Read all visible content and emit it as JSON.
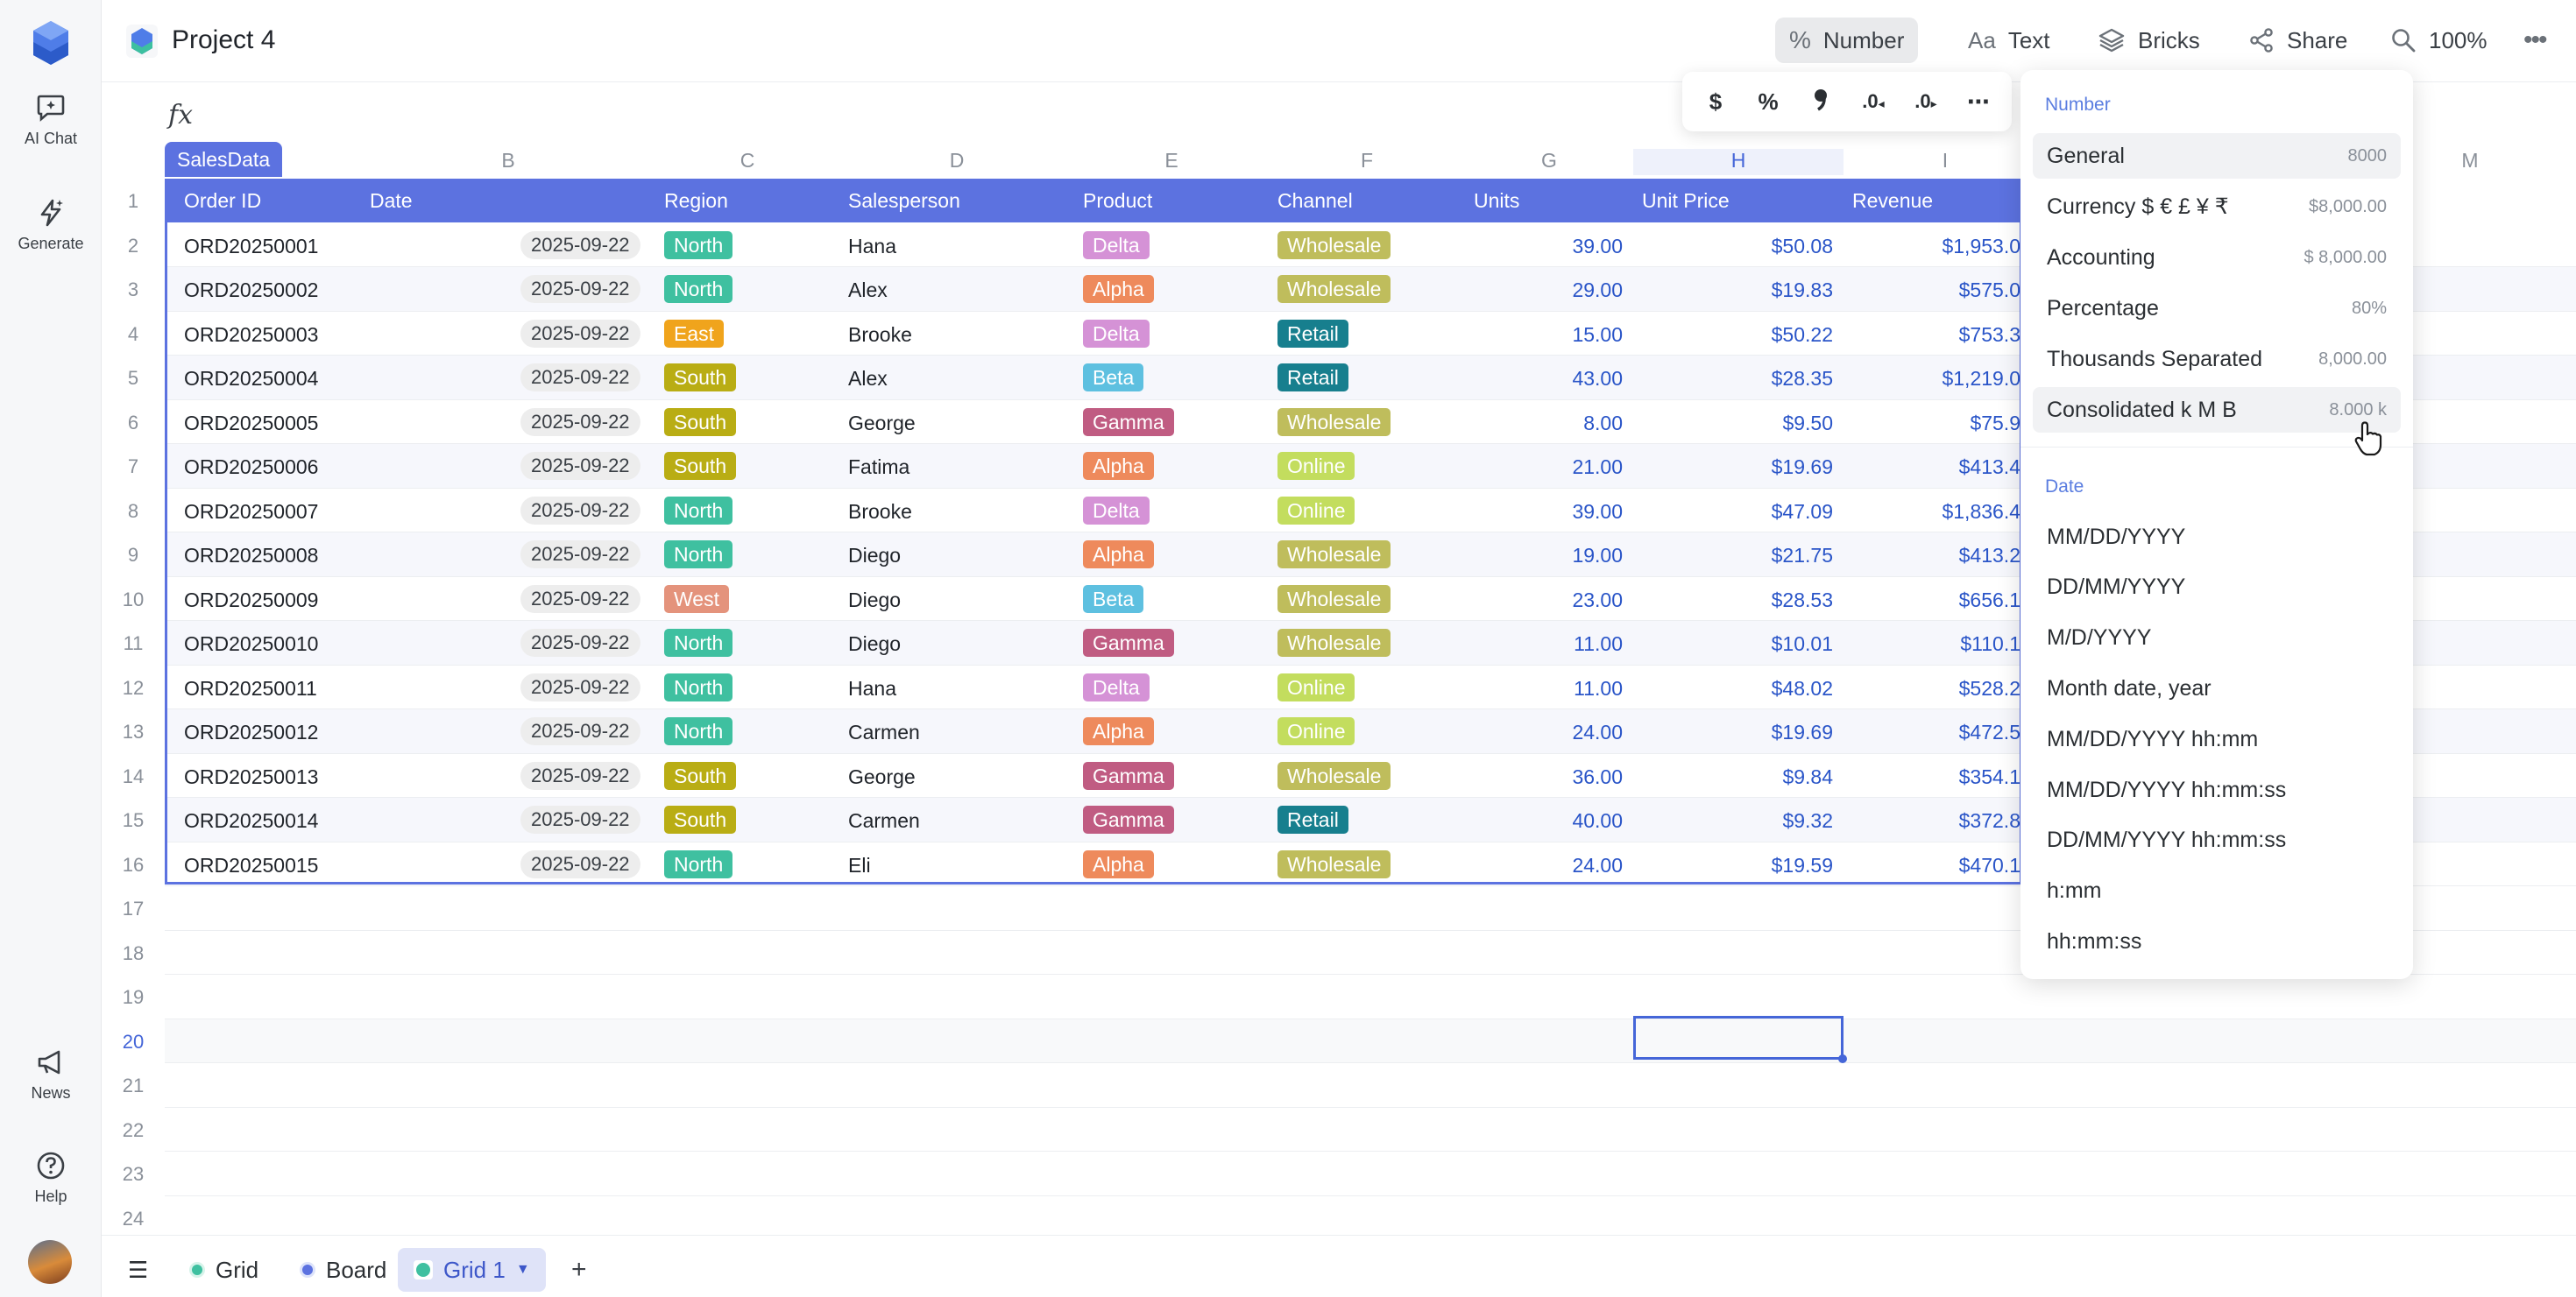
{
  "app": {
    "project_title": "Project 4"
  },
  "rail": {
    "items": [
      {
        "label": "AI Chat"
      },
      {
        "label": "Generate"
      },
      {
        "label": "News"
      },
      {
        "label": "Help"
      }
    ]
  },
  "toolbar": {
    "number_label": "Number",
    "text_label": "Text",
    "bricks_label": "Bricks",
    "share_label": "Share",
    "zoom_label": "100%"
  },
  "formula": {
    "fx_label": "fx"
  },
  "format_bar": {
    "currency": "$",
    "percent": "%",
    "decrease_decimals": ".0",
    "increase_decimals": ".0",
    "more": "⋯"
  },
  "sheet": {
    "table_name": "SalesData",
    "column_letters": [
      "B",
      "C",
      "D",
      "E",
      "F",
      "G",
      "H",
      "I",
      "M"
    ],
    "headers": [
      "Order ID",
      "Date",
      "Region",
      "Salesperson",
      "Product",
      "Channel",
      "Units",
      "Unit Price",
      "Revenue"
    ],
    "row_numbers": [
      "1",
      "2",
      "3",
      "4",
      "5",
      "6",
      "7",
      "8",
      "9",
      "10",
      "11",
      "12",
      "13",
      "14",
      "15",
      "16",
      "17",
      "18",
      "19",
      "20",
      "21",
      "22",
      "23",
      "24"
    ],
    "rows": [
      {
        "id": "ORD20250001",
        "date": "2025-09-22",
        "region": "North",
        "sp": "Hana",
        "product": "Delta",
        "channel": "Wholesale",
        "units": "39.00",
        "price": "$50.08",
        "revenue": "$1,953.0"
      },
      {
        "id": "ORD20250002",
        "date": "2025-09-22",
        "region": "North",
        "sp": "Alex",
        "product": "Alpha",
        "channel": "Wholesale",
        "units": "29.00",
        "price": "$19.83",
        "revenue": "$575.0"
      },
      {
        "id": "ORD20250003",
        "date": "2025-09-22",
        "region": "East",
        "sp": "Brooke",
        "product": "Delta",
        "channel": "Retail",
        "units": "15.00",
        "price": "$50.22",
        "revenue": "$753.3"
      },
      {
        "id": "ORD20250004",
        "date": "2025-09-22",
        "region": "South",
        "sp": "Alex",
        "product": "Beta",
        "channel": "Retail",
        "units": "43.00",
        "price": "$28.35",
        "revenue": "$1,219.0"
      },
      {
        "id": "ORD20250005",
        "date": "2025-09-22",
        "region": "South",
        "sp": "George",
        "product": "Gamma",
        "channel": "Wholesale",
        "units": "8.00",
        "price": "$9.50",
        "revenue": "$75.9"
      },
      {
        "id": "ORD20250006",
        "date": "2025-09-22",
        "region": "South",
        "sp": "Fatima",
        "product": "Alpha",
        "channel": "Online",
        "units": "21.00",
        "price": "$19.69",
        "revenue": "$413.4"
      },
      {
        "id": "ORD20250007",
        "date": "2025-09-22",
        "region": "North",
        "sp": "Brooke",
        "product": "Delta",
        "channel": "Online",
        "units": "39.00",
        "price": "$47.09",
        "revenue": "$1,836.4"
      },
      {
        "id": "ORD20250008",
        "date": "2025-09-22",
        "region": "North",
        "sp": "Diego",
        "product": "Alpha",
        "channel": "Wholesale",
        "units": "19.00",
        "price": "$21.75",
        "revenue": "$413.2"
      },
      {
        "id": "ORD20250009",
        "date": "2025-09-22",
        "region": "West",
        "sp": "Diego",
        "product": "Beta",
        "channel": "Wholesale",
        "units": "23.00",
        "price": "$28.53",
        "revenue": "$656.1"
      },
      {
        "id": "ORD20250010",
        "date": "2025-09-22",
        "region": "North",
        "sp": "Diego",
        "product": "Gamma",
        "channel": "Wholesale",
        "units": "11.00",
        "price": "$10.01",
        "revenue": "$110.1"
      },
      {
        "id": "ORD20250011",
        "date": "2025-09-22",
        "region": "North",
        "sp": "Hana",
        "product": "Delta",
        "channel": "Online",
        "units": "11.00",
        "price": "$48.02",
        "revenue": "$528.2"
      },
      {
        "id": "ORD20250012",
        "date": "2025-09-22",
        "region": "North",
        "sp": "Carmen",
        "product": "Alpha",
        "channel": "Online",
        "units": "24.00",
        "price": "$19.69",
        "revenue": "$472.5"
      },
      {
        "id": "ORD20250013",
        "date": "2025-09-22",
        "region": "South",
        "sp": "George",
        "product": "Gamma",
        "channel": "Wholesale",
        "units": "36.00",
        "price": "$9.84",
        "revenue": "$354.1"
      },
      {
        "id": "ORD20250014",
        "date": "2025-09-22",
        "region": "South",
        "sp": "Carmen",
        "product": "Gamma",
        "channel": "Retail",
        "units": "40.00",
        "price": "$9.32",
        "revenue": "$372.8"
      },
      {
        "id": "ORD20250015",
        "date": "2025-09-22",
        "region": "North",
        "sp": "Eli",
        "product": "Alpha",
        "channel": "Wholesale",
        "units": "24.00",
        "price": "$19.59",
        "revenue": "$470.1"
      }
    ]
  },
  "tag_colors": {
    "North": "#3fc0a0",
    "South": "#b9ad14",
    "East": "#f0a41c",
    "West": "#e4937c",
    "Delta": "#d592d6",
    "Alpha": "#ee8a5c",
    "Beta": "#5ec0e0",
    "Gamma": "#c05c82",
    "Wholesale": "#bfbd5c",
    "Retail": "#177f8e",
    "Online": "#c3dd5e"
  },
  "dropdown": {
    "number_header": "Number",
    "number_items": [
      {
        "label": "General",
        "example": "8000"
      },
      {
        "label": "Currency $ € £ ¥ ₹",
        "example": "$8,000.00"
      },
      {
        "label": "Accounting",
        "example": "$ 8,000.00"
      },
      {
        "label": "Percentage",
        "example": "80%"
      },
      {
        "label": "Thousands Separated",
        "example": "8,000.00"
      },
      {
        "label": "Consolidated k M B",
        "example": "8.000 k"
      }
    ],
    "date_header": "Date",
    "date_items": [
      {
        "label": "MM/DD/YYYY"
      },
      {
        "label": "DD/MM/YYYY"
      },
      {
        "label": "M/D/YYYY"
      },
      {
        "label": "Month date, year"
      },
      {
        "label": "MM/DD/YYYY hh:mm"
      },
      {
        "label": "MM/DD/YYYY hh:mm:ss"
      },
      {
        "label": "DD/MM/YYYY hh:mm:ss"
      },
      {
        "label": "h:mm"
      },
      {
        "label": "hh:mm:ss"
      }
    ]
  },
  "bottom": {
    "menu_icon": "☰",
    "tabs": [
      {
        "label": "Grid"
      },
      {
        "label": "Board"
      },
      {
        "label": "Grid 1"
      }
    ],
    "add_label": "+"
  }
}
